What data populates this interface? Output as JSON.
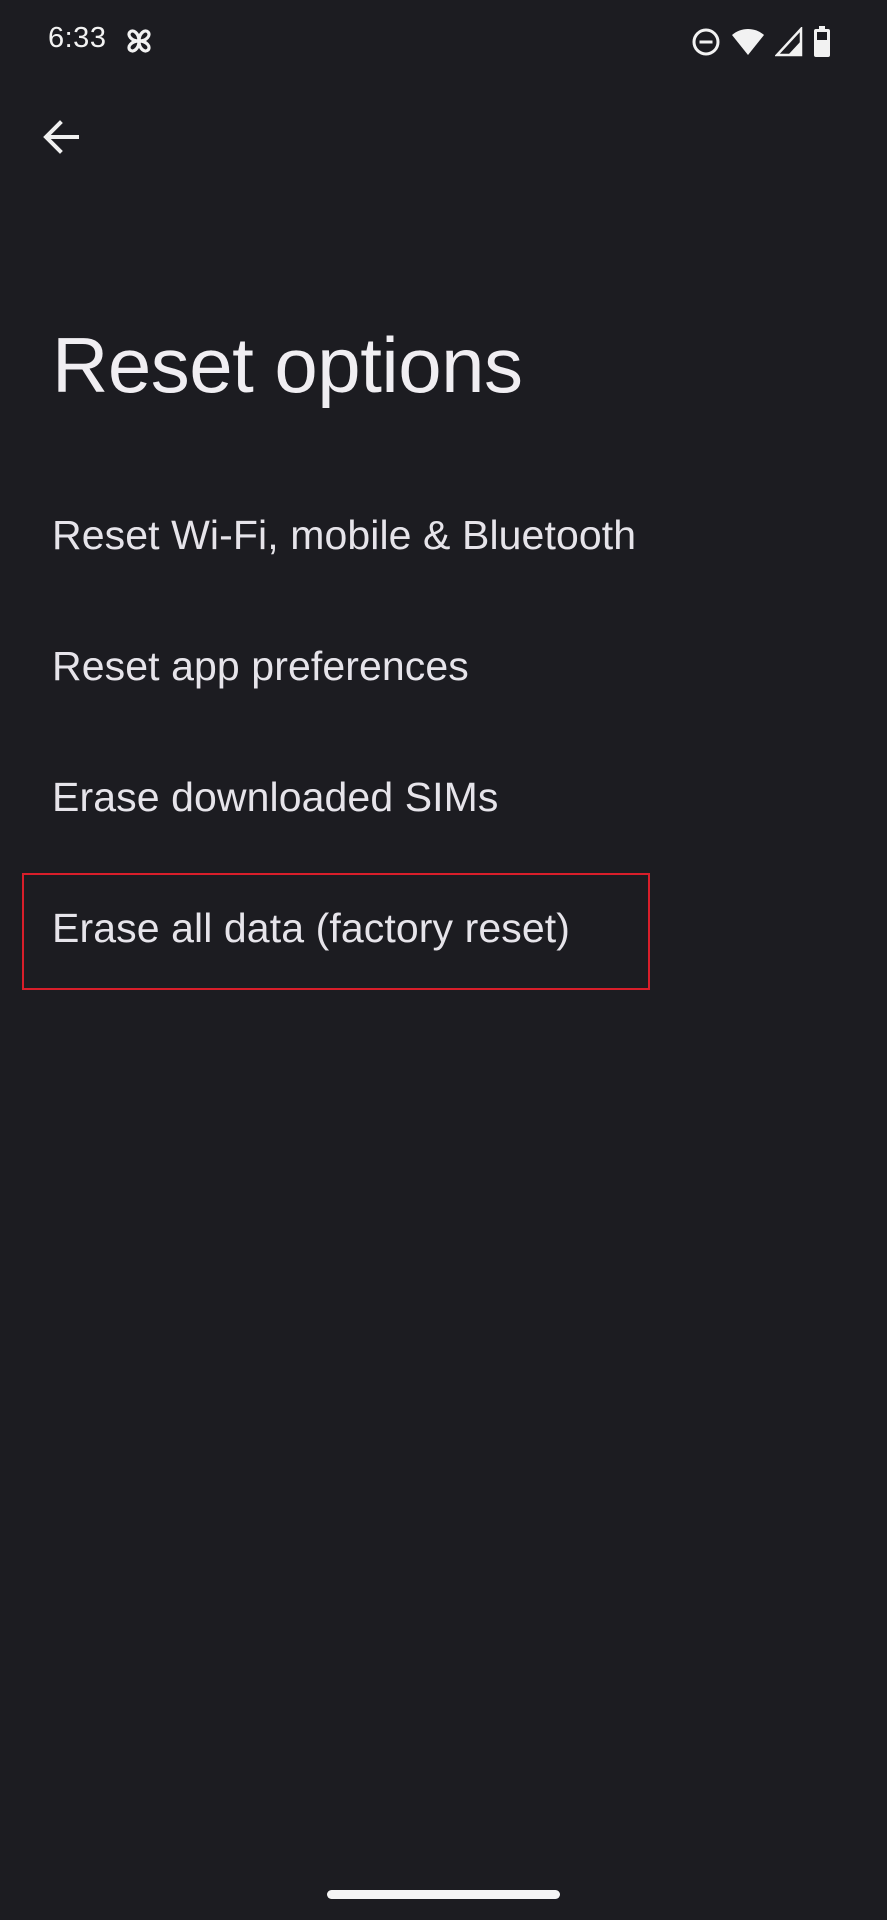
{
  "status_bar": {
    "time": "6:33",
    "app_icon": "pinwheel-icon",
    "icons": [
      "do-not-disturb-icon",
      "wifi-icon",
      "cellular-signal-icon",
      "battery-icon"
    ]
  },
  "header": {
    "back_icon": "back-arrow-icon"
  },
  "page": {
    "title": "Reset options"
  },
  "options": [
    {
      "label": "Reset Wi-Fi, mobile & Bluetooth"
    },
    {
      "label": "Reset app preferences"
    },
    {
      "label": "Erase downloaded SIMs"
    },
    {
      "label": "Erase all data (factory reset)",
      "highlighted": true
    }
  ],
  "colors": {
    "background": "#1c1c21",
    "text": "#e6e4ea",
    "highlight_border": "#d81e2a"
  }
}
